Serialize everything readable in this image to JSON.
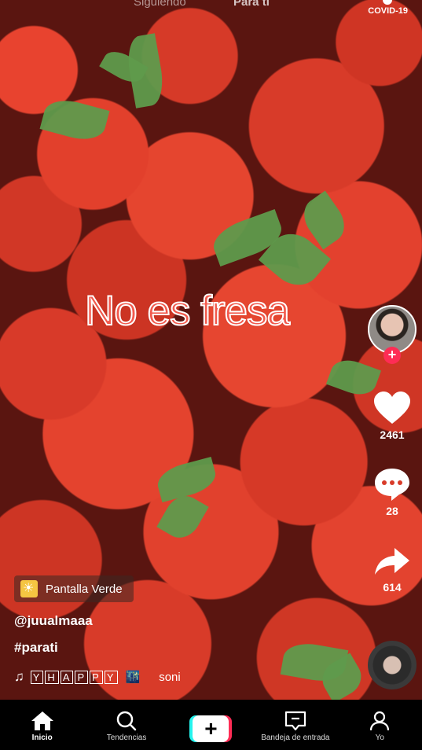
{
  "top_bar": {
    "following_tab": "Siguiendo",
    "for_you_tab": "Para ti",
    "covid_label": "COVID-19"
  },
  "video": {
    "overlay_text": "No es fresa"
  },
  "actions": {
    "likes": "2461",
    "comments": "28",
    "shares": "614"
  },
  "post": {
    "effect_label": "Pantalla Verde",
    "username": "@juualmaaa",
    "hashtag": "#parati",
    "music_title": "YHAPPY",
    "music_scroll": "soni"
  },
  "nav": {
    "home": "Inicio",
    "discover": "Tendencias",
    "inbox": "Bandeja de entrada",
    "profile": "Yo"
  },
  "colors": {
    "like_pink": "#fe2c55",
    "cyan": "#25f4ee",
    "overlay_text": "#f25a4d"
  }
}
